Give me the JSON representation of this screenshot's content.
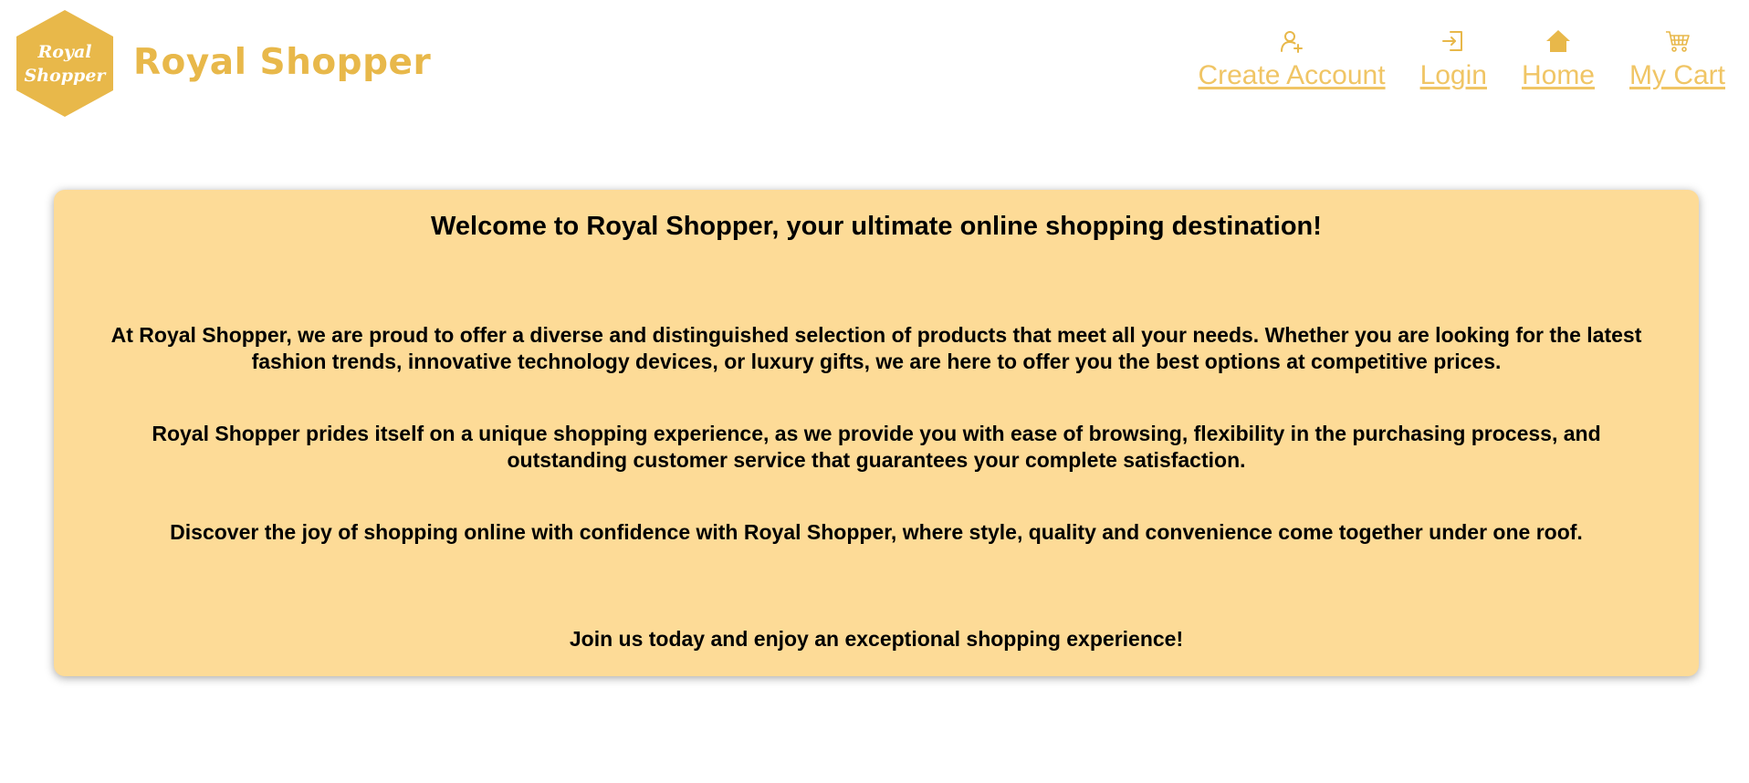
{
  "header": {
    "logo": {
      "line1": "Royal",
      "line2": "Shopper",
      "color": "#e8b84a"
    },
    "brand_name": "Royal Shopper",
    "nav": [
      {
        "label": "Create Account",
        "icon": "user-plus-icon"
      },
      {
        "label": "Login",
        "icon": "login-icon"
      },
      {
        "label": "Home",
        "icon": "home-icon"
      },
      {
        "label": "My Cart",
        "icon": "cart-icon"
      }
    ]
  },
  "main": {
    "title": "Welcome to Royal Shopper, your ultimate online shopping destination!",
    "paragraphs": [
      "At Royal Shopper, we are proud to offer a diverse and distinguished selection of products that meet all your needs. Whether you are looking for the latest fashion trends, innovative technology devices, or luxury gifts, we are here to offer you the best options at competitive prices.",
      "Royal Shopper prides itself on a unique shopping experience, as we provide you with ease of browsing, flexibility in the purchasing process, and outstanding customer service that guarantees your complete satisfaction.",
      "Discover the joy of shopping online with confidence with Royal Shopper, where style, quality and convenience come together under one roof.",
      "Join us today and enjoy an exceptional shopping experience!"
    ]
  },
  "colors": {
    "brand": "#e8b84a",
    "nav_link": "#f0c565",
    "card_background": "#fddb97",
    "text": "#000000"
  }
}
